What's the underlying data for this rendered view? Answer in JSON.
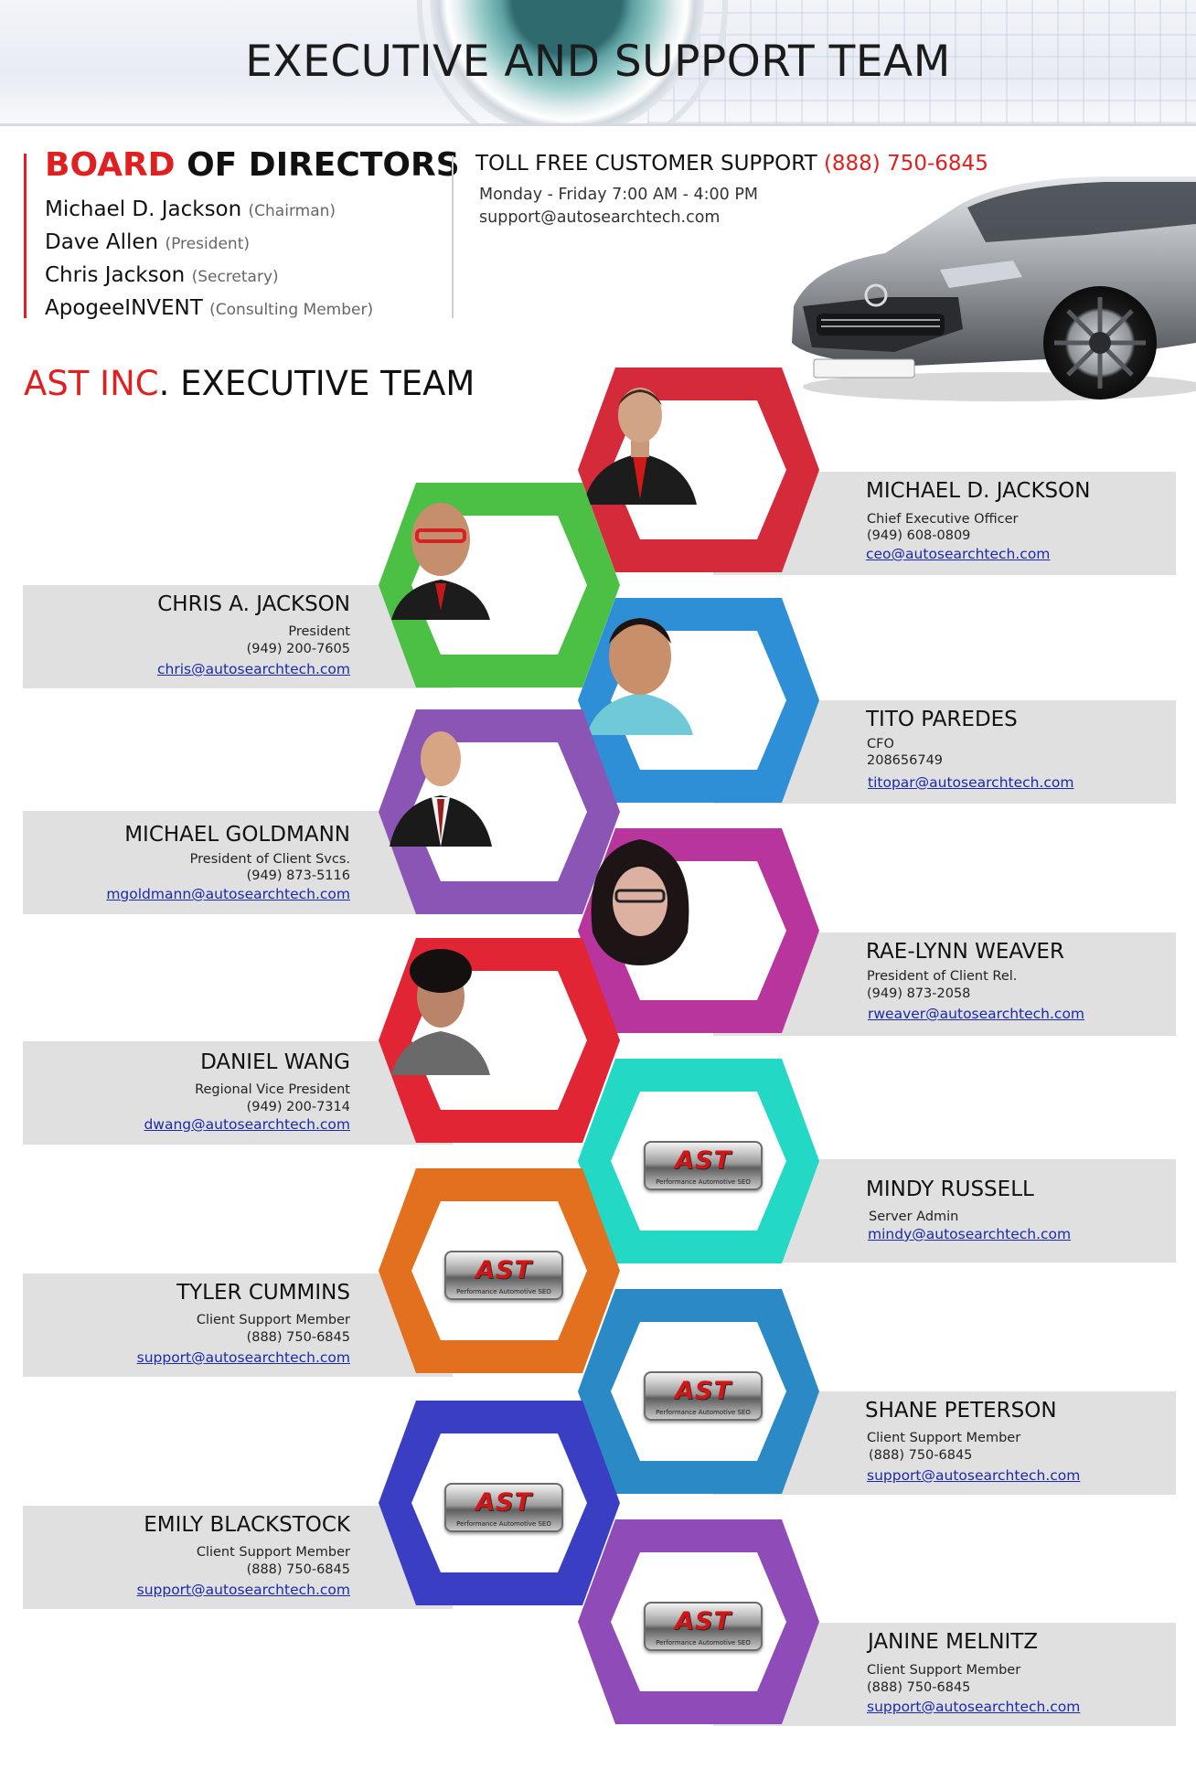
{
  "header": {
    "title": "EXECUTIVE AND SUPPORT TEAM"
  },
  "board": {
    "title_red": "BOARD",
    "title_rest": " OF DIRECTORS",
    "members": [
      {
        "name": "Michael D. Jackson",
        "role": "(Chairman)"
      },
      {
        "name": "Dave Allen",
        "role": "(President)"
      },
      {
        "name": "Chris Jackson",
        "role": "(Secretary)"
      },
      {
        "name": "ApogeeINVENT",
        "role": "(Consulting Member)"
      }
    ]
  },
  "support": {
    "title": "TOLL FREE CUSTOMER SUPPORT ",
    "phone": "(888) 750-6845",
    "hours": "Monday - Friday 7:00 AM - 4:00 PM",
    "email": "support@autosearchtech.com"
  },
  "exec": {
    "title_red": "AST INC",
    "title_rest": ". EXECUTIVE TEAM"
  },
  "logo": {
    "text": "AST",
    "subtext": "Performance Automotive SEO"
  },
  "team": [
    {
      "name": "MICHAEL D. JACKSON",
      "title": "Chief Executive Officer",
      "phone": "(949) 608-0809",
      "email": "ceo@autosearchtech.com",
      "color": "#d42a3a"
    },
    {
      "name": "CHRIS A. JACKSON",
      "title": "President",
      "phone": "(949) 200-7605",
      "email": "chris@autosearchtech.com",
      "color": "#4cbf45"
    },
    {
      "name": "TITO PAREDES",
      "title": "CFO",
      "phone": "208656749",
      "email": "titopar@autosearchtech.com",
      "color": "#2e8fd6"
    },
    {
      "name": "MICHAEL GOLDMANN",
      "title": "President of Client Svcs.",
      "phone": "(949) 873-5116",
      "email": "mgoldmann@autosearchtech.com",
      "color": "#8a55b5"
    },
    {
      "name": "RAE-LYNN WEAVER",
      "title": "President of Client Rel.",
      "phone": "(949) 873-2058",
      "email": "rweaver@autosearchtech.com",
      "color": "#b8359e"
    },
    {
      "name": "DANIEL WANG",
      "title": "Regional Vice President",
      "phone": "(949) 200-7314",
      "email": "dwang@autosearchtech.com",
      "color": "#e12535"
    },
    {
      "name": "MINDY RUSSELL",
      "title": "Server Admin",
      "phone": "",
      "email": "mindy@autosearchtech.com",
      "color": "#24d8c6"
    },
    {
      "name": "TYLER CUMMINS",
      "title": "Client Support Member",
      "phone": "(888) 750-6845",
      "email": "support@autosearchtech.com",
      "color": "#e2701f"
    },
    {
      "name": "SHANE PETERSON",
      "title": "Client Support Member",
      "phone": "(888) 750-6845",
      "email": "support@autosearchtech.com",
      "color": "#2b8ac6"
    },
    {
      "name": "EMILY BLACKSTOCK",
      "title": "Client Support Member",
      "phone": "(888) 750-6845",
      "email": "support@autosearchtech.com",
      "color": "#3a3ec2"
    },
    {
      "name": "JANINE MELNITZ",
      "title": "Client Support Member",
      "phone": "(888) 750-6845",
      "email": "support@autosearchtech.com",
      "color": "#8f4cb8"
    }
  ]
}
